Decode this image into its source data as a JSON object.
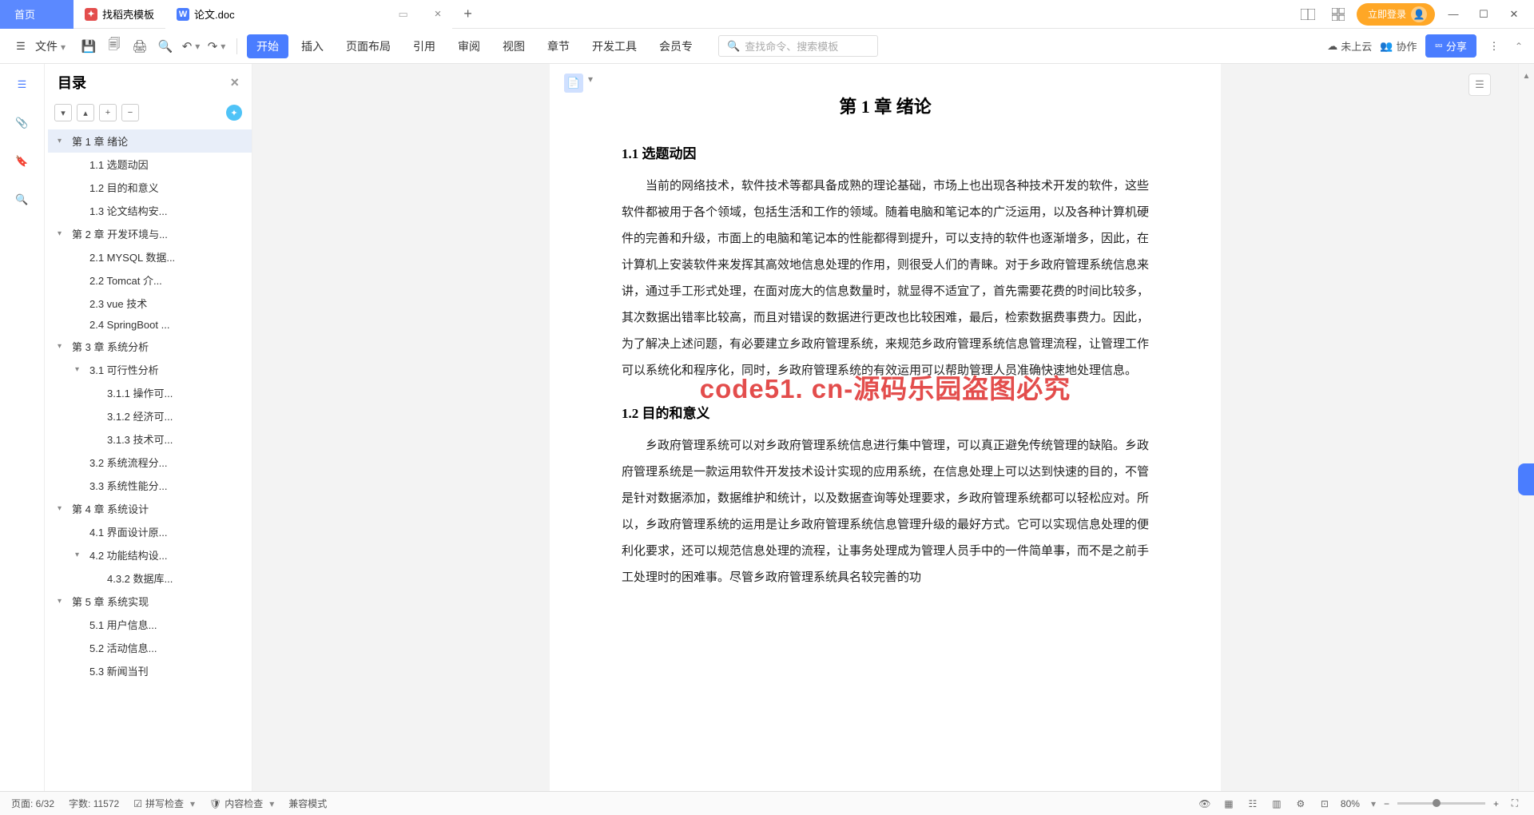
{
  "tabs": {
    "home": "首页",
    "template": "找稻壳模板",
    "doc": "论文.doc"
  },
  "titlebar": {
    "login": "立即登录"
  },
  "toolbar": {
    "file": "文件",
    "menus": [
      "开始",
      "插入",
      "页面布局",
      "引用",
      "审阅",
      "视图",
      "章节",
      "开发工具",
      "会员专"
    ],
    "search_placeholder": "查找命令、搜索模板",
    "cloud": "未上云",
    "collab": "协作",
    "share": "分享"
  },
  "outline": {
    "title": "目录",
    "items": [
      {
        "level": 0,
        "caret": "▾",
        "text": "第 1 章  绪论",
        "selected": true
      },
      {
        "level": 1,
        "caret": "",
        "text": "1.1 选题动因"
      },
      {
        "level": 1,
        "caret": "",
        "text": "1.2 目的和意义"
      },
      {
        "level": 1,
        "caret": "",
        "text": "1.3 论文结构安..."
      },
      {
        "level": 0,
        "caret": "▾",
        "text": "第 2 章  开发环境与..."
      },
      {
        "level": 1,
        "caret": "",
        "text": "2.1 MYSQL 数据..."
      },
      {
        "level": 1,
        "caret": "",
        "text": "2.2 Tomcat  介..."
      },
      {
        "level": 1,
        "caret": "",
        "text": "2.3 vue 技术"
      },
      {
        "level": 1,
        "caret": "",
        "text": "2.4 SpringBoot ..."
      },
      {
        "level": 0,
        "caret": "▾",
        "text": "第 3 章  系统分析"
      },
      {
        "level": 1,
        "caret": "▾",
        "text": "3.1 可行性分析"
      },
      {
        "level": 2,
        "caret": "",
        "text": "3.1.1 操作可..."
      },
      {
        "level": 2,
        "caret": "",
        "text": "3.1.2 经济可..."
      },
      {
        "level": 2,
        "caret": "",
        "text": "3.1.3 技术可..."
      },
      {
        "level": 1,
        "caret": "",
        "text": "3.2 系统流程分..."
      },
      {
        "level": 1,
        "caret": "",
        "text": "3.3 系统性能分..."
      },
      {
        "level": 0,
        "caret": "▾",
        "text": "第 4 章  系统设计"
      },
      {
        "level": 1,
        "caret": "",
        "text": "4.1 界面设计原..."
      },
      {
        "level": 1,
        "caret": "▾",
        "text": "4.2 功能结构设..."
      },
      {
        "level": 2,
        "caret": "",
        "text": "4.3.2  数据库..."
      },
      {
        "level": 0,
        "caret": "▾",
        "text": "第 5 章  系统实现"
      },
      {
        "level": 1,
        "caret": "",
        "text": "5.1 用户信息..."
      },
      {
        "level": 1,
        "caret": "",
        "text": "5.2 活动信息..."
      },
      {
        "level": 1,
        "caret": "",
        "text": "5.3 新闻当刊"
      }
    ]
  },
  "document": {
    "chapter_title": "第 1 章  绪论",
    "h1_1": "1.1 选题动因",
    "p1": "当前的网络技术，软件技术等都具备成熟的理论基础，市场上也出现各种技术开发的软件，这些软件都被用于各个领域，包括生活和工作的领域。随着电脑和笔记本的广泛运用，以及各种计算机硬件的完善和升级，市面上的电脑和笔记本的性能都得到提升，可以支持的软件也逐渐增多，因此，在计算机上安装软件来发挥其高效地信息处理的作用，则很受人们的青睐。对于乡政府管理系统信息来讲，通过手工形式处理，在面对庞大的信息数量时，就显得不适宜了，首先需要花费的时间比较多，其次数据出错率比较高，而且对错误的数据进行更改也比较困难，最后，检索数据费事费力。因此，为了解决上述问题，有必要建立乡政府管理系统，来规范乡政府管理系统信息管理流程，让管理工作可以系统化和程序化，同时，乡政府管理系统的有效运用可以帮助管理人员准确快速地处理信息。",
    "h1_2": "1.2 目的和意义",
    "p2": "乡政府管理系统可以对乡政府管理系统信息进行集中管理，可以真正避免传统管理的缺陷。乡政府管理系统是一款运用软件开发技术设计实现的应用系统，在信息处理上可以达到快速的目的，不管是针对数据添加，数据维护和统计，以及数据查询等处理要求，乡政府管理系统都可以轻松应对。所以，乡政府管理系统的运用是让乡政府管理系统信息管理升级的最好方式。它可以实现信息处理的便利化要求，还可以规范信息处理的流程，让事务处理成为管理人员手中的一件简单事，而不是之前手工处理时的困难事。尽管乡政府管理系统具名较完善的功"
  },
  "watermark": "code51. cn-源码乐园盗图必究",
  "status": {
    "page": "页面: 6/32",
    "words": "字数: 11572",
    "spell": "拼写检查",
    "content": "内容检查",
    "compat": "兼容模式",
    "zoom": "80%"
  }
}
